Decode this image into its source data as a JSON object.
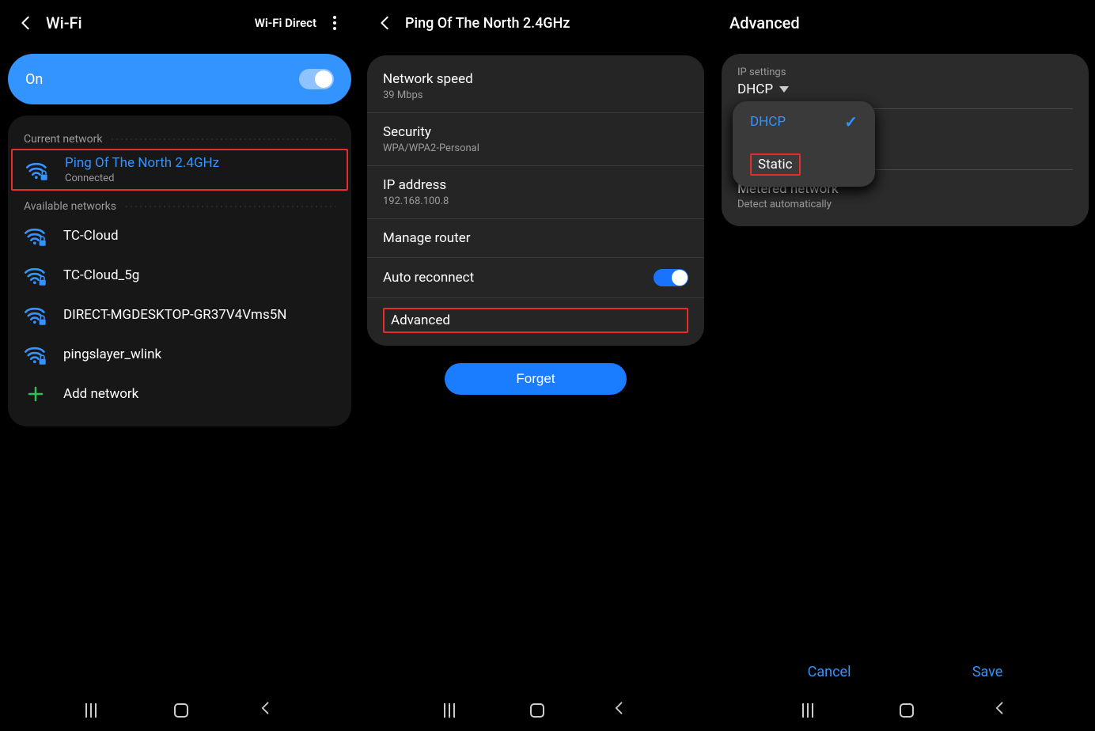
{
  "screen1": {
    "title": "Wi-Fi",
    "wifi_direct": "Wi-Fi Direct",
    "on_label": "On",
    "current_hdr": "Current network",
    "current": {
      "name": "Ping Of The North 2.4GHz",
      "status": "Connected"
    },
    "available_hdr": "Available networks",
    "available": [
      {
        "name": "TC-Cloud"
      },
      {
        "name": "TC-Cloud_5g"
      },
      {
        "name": "DIRECT-MGDESKTOP-GR37V4Vms5N"
      },
      {
        "name": "pingslayer_wlink"
      }
    ],
    "add_label": "Add network"
  },
  "screen2": {
    "title": "Ping Of The North 2.4GHz",
    "rows": {
      "speed_label": "Network speed",
      "speed_val": "39 Mbps",
      "sec_label": "Security",
      "sec_val": "WPA/WPA2-Personal",
      "ip_label": "IP address",
      "ip_val": "192.168.100.8",
      "router_label": "Manage router",
      "auto_label": "Auto reconnect",
      "adv_label": "Advanced"
    },
    "forget": "Forget"
  },
  "screen3": {
    "title": "Advanced",
    "ip_settings_label": "IP settings",
    "ip_settings_value": "DHCP",
    "dropdown": {
      "dhcp": "DHCP",
      "static": "Static"
    },
    "metered_label": "Metered network",
    "metered_sub": "Detect automatically",
    "cancel": "Cancel",
    "save": "Save"
  }
}
